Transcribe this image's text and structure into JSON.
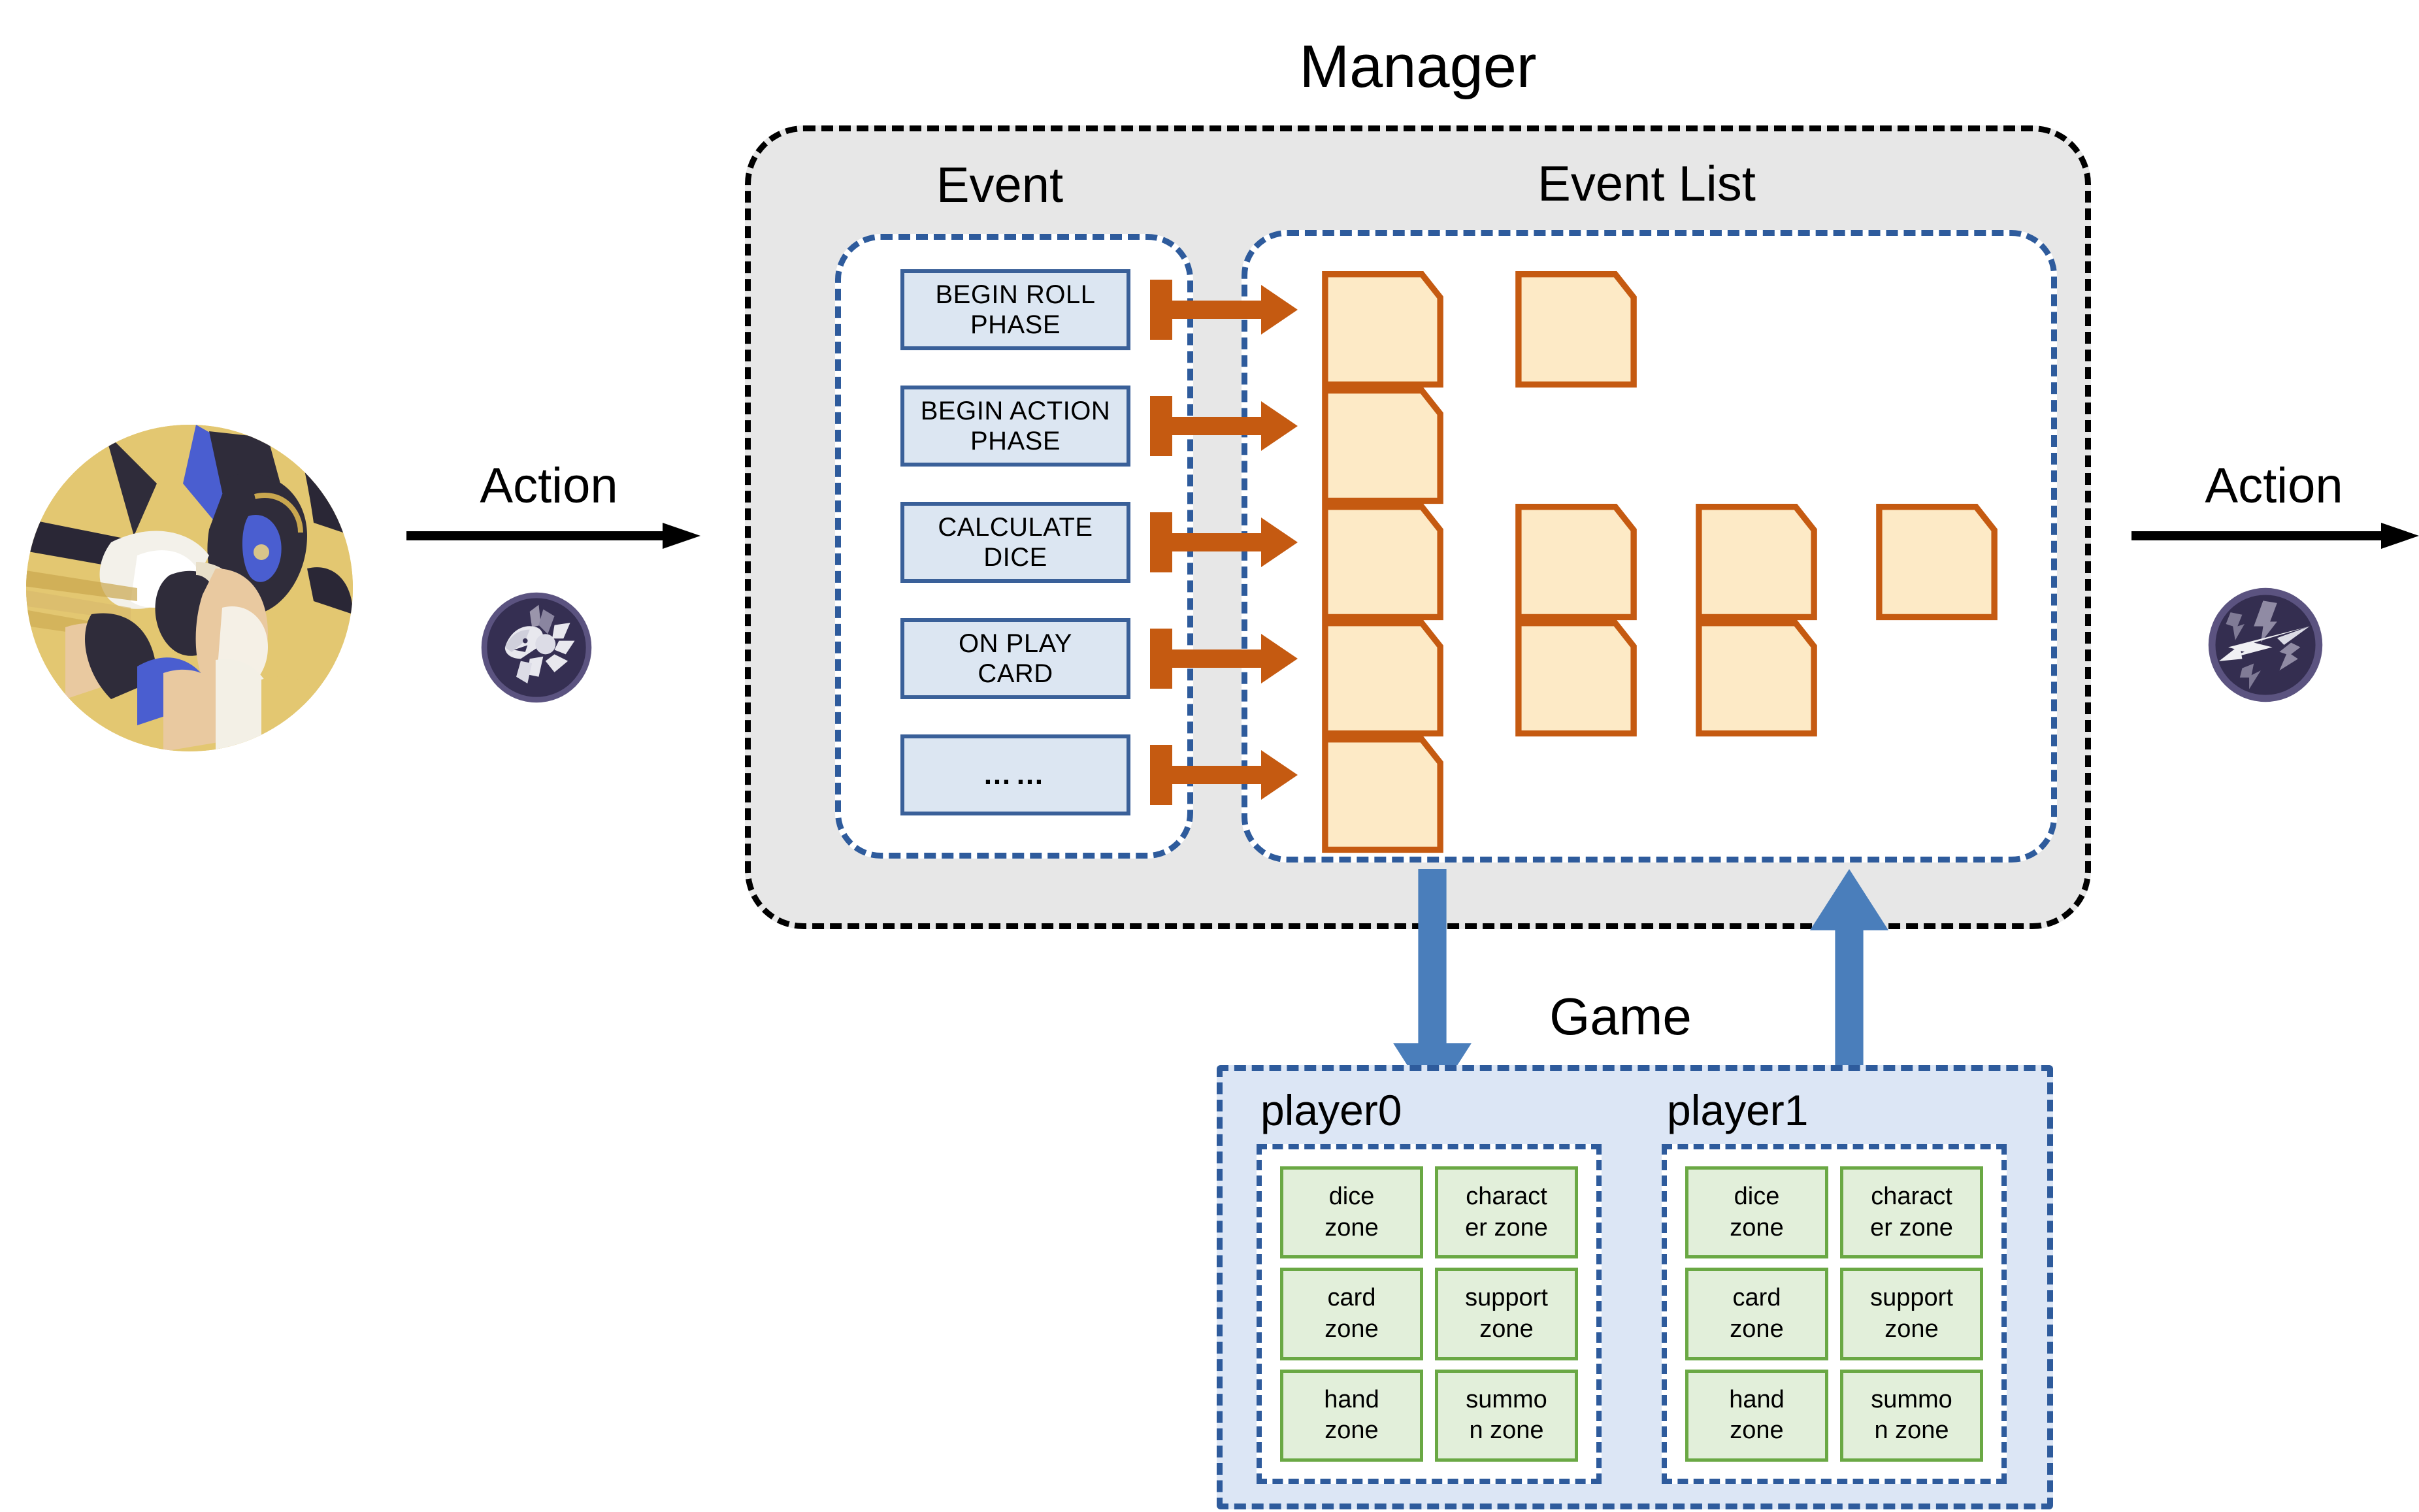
{
  "left_actor": {
    "avatar_name": "character-avatar",
    "action_label": "Action",
    "element_badge": "jackal-head-icon"
  },
  "right_actor": {
    "action_label": "Action",
    "element_badge": "electro-bolt-icon"
  },
  "manager": {
    "title": "Manager",
    "event_section": {
      "title": "Event",
      "events": [
        {
          "lines": [
            "BEGIN ROLL",
            "PHASE"
          ]
        },
        {
          "lines": [
            "BEGIN ACTION",
            "PHASE"
          ]
        },
        {
          "lines": [
            "CALCULATE",
            "DICE"
          ]
        },
        {
          "lines": [
            "ON PLAY",
            "CARD"
          ]
        },
        {
          "lines": [
            "……"
          ]
        }
      ]
    },
    "event_list_section": {
      "title": "Event List",
      "rows": [
        {
          "card_count": 2
        },
        {
          "card_count": 1
        },
        {
          "card_count": 4
        },
        {
          "card_count": 3
        },
        {
          "card_count": 1
        }
      ]
    }
  },
  "flow_arrows": {
    "manager_to_game": "down-arrow",
    "game_to_manager": "up-arrow"
  },
  "game": {
    "title": "Game",
    "players": [
      {
        "name": "player0",
        "zones": [
          {
            "lines": [
              "dice",
              "zone"
            ]
          },
          {
            "lines": [
              "charact",
              "er zone"
            ]
          },
          {
            "lines": [
              "card",
              "zone"
            ]
          },
          {
            "lines": [
              "support",
              "zone"
            ]
          },
          {
            "lines": [
              "hand",
              "zone"
            ]
          },
          {
            "lines": [
              "summo",
              "n zone"
            ]
          }
        ]
      },
      {
        "name": "player1",
        "zones": [
          {
            "lines": [
              "dice",
              "zone"
            ]
          },
          {
            "lines": [
              "charact",
              "er zone"
            ]
          },
          {
            "lines": [
              "card",
              "zone"
            ]
          },
          {
            "lines": [
              "support",
              "zone"
            ]
          },
          {
            "lines": [
              "hand",
              "zone"
            ]
          },
          {
            "lines": [
              "summo",
              "n zone"
            ]
          }
        ]
      }
    ]
  },
  "colors": {
    "manager_fill": "#e7e7e7",
    "manager_border": "#000000",
    "inner_border": "#2e5b9c",
    "event_box_fill": "#dce6f2",
    "event_box_border": "#3a6099",
    "card_fill": "#fdeac6",
    "card_border": "#c55a11",
    "connector": "#c55a11",
    "blue_arrow": "#4a7ebb",
    "game_fill": "#dce6f5",
    "zone_fill": "#e2efda",
    "zone_border": "#6aa844",
    "badge_bg": "#3a3358",
    "badge_ring": "#5b5380"
  }
}
